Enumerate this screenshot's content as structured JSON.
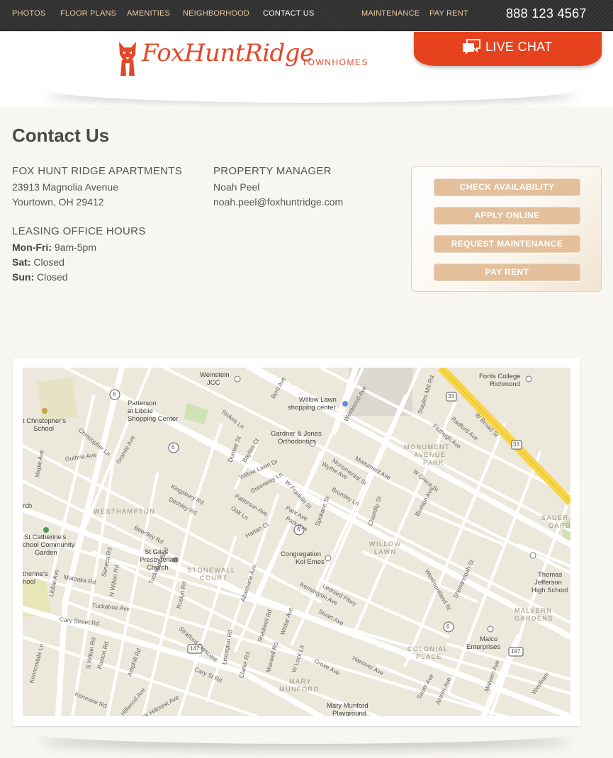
{
  "nav": {
    "items": [
      {
        "label": "PHOTOS"
      },
      {
        "label": "FLOOR PLANS"
      },
      {
        "label": "AMENITIES"
      },
      {
        "label": "NEIGHBORHOOD"
      },
      {
        "label": "CONTACT US",
        "active": true
      },
      {
        "label": "MAINTENANCE"
      },
      {
        "label": "PAY RENT"
      }
    ],
    "phone": "888 123 4567"
  },
  "brand": {
    "name": "FoxHuntRidge",
    "suffix": "TOWNHOMES",
    "accent": "#e2492a",
    "logo_icon": "fox-icon"
  },
  "live_chat": {
    "label": "LIVE CHAT",
    "icon": "chat-bubbles-icon",
    "color": "#e7421e"
  },
  "page": {
    "title": "Contact Us"
  },
  "contact": {
    "property": {
      "heading": "FOX HUNT RIDGE APARTMENTS",
      "street": "23913 Magnolia Avenue",
      "city": "Yourtown, OH 29412"
    },
    "manager": {
      "heading": "PROPERTY MANAGER",
      "name": "Noah Peel",
      "email": "noah.peel@foxhuntridge.com"
    },
    "hours": {
      "heading": "LEASING OFFICE HOURS",
      "rows": [
        {
          "day": "Mon-Fri:",
          "time": "9am-5pm"
        },
        {
          "day": "Sat:",
          "time": "Closed"
        },
        {
          "day": "Sun:",
          "time": "Closed"
        }
      ]
    }
  },
  "actions": {
    "buttons": [
      {
        "label": "CHECK AVAILABILITY"
      },
      {
        "label": "APPLY ONLINE"
      },
      {
        "label": "REQUEST MAINTENANCE"
      },
      {
        "label": "PAY RENT"
      }
    ],
    "button_color": "#e3bf9c"
  },
  "map": {
    "areas": [
      "WESTHAMPTON",
      "STONEWALL",
      "COURT",
      "MONUMENT",
      "AVENUE",
      "PARK",
      "WILLOW",
      "LAWN",
      "MALVERN",
      "GARDENS",
      "COLONIAL",
      "PLACE",
      "MARY",
      "MUNFORD",
      "SAUER",
      "GARDE"
    ],
    "pois": [
      "Weinstein",
      "JCC",
      "Willow Lawn",
      "shopping center",
      "Patterson",
      "at Libbie",
      "Shopping Center",
      "t Christopher's",
      "School",
      "Gardner & Jones",
      "Orthodontics",
      "Fortis College",
      "Richmond",
      "St Catherine's",
      "chool Community",
      "Garden",
      "St Giles",
      "Presbyterian",
      "Church",
      "Congregation",
      "Kol Emes",
      "therine's",
      "hool",
      "Thomas",
      "Jefferson",
      "High School",
      "Malco",
      "Enterprises",
      "Mary Munford",
      "Playground",
      "rch"
    ],
    "roads": [
      "Libbie Ave",
      "Patterson Ave",
      "Monument Ave",
      "Grove Ave",
      "Cary Street Rd",
      "Cary St Rd",
      "W Broad St",
      "Willow Lawn Dr",
      "Kensington Ave",
      "Stuart Ave",
      "Malvern Ave",
      "Tuckahoe Ave",
      "Matoaka Rd",
      "Granite Ave",
      "Maple Ave",
      "Guthrie Ave",
      "Christopher Ln",
      "Stokes Ln",
      "Dunbar St",
      "Bayliss Ct",
      "Greenway Ln",
      "W Franklin St",
      "Park Ave",
      "Wythe Ave",
      "Bromley Ln",
      "Monumental St",
      "Chantilly St",
      "Spokane St",
      "Kingsbury Rd",
      "Ditchley Rd",
      "Bewdley Rd",
      "Oak Ln",
      "Harlan Ct",
      "Albemarle Ave",
      "Leonard Pkwy",
      "Shadwell Rd",
      "Wistar Ave",
      "W Lock Ln",
      "Maxwell Rd",
      "Clarke Rd",
      "Lexington Rd",
      "Roslyn Rd",
      "Stratford Crescent",
      "Hanover Ave",
      "Sauer Ave",
      "Antrim Ave",
      "Westmoreland St",
      "Shenandoah St",
      "Blanton Ave",
      "Staples Mill Rd",
      "Radford Ave",
      "Fitzhugh Ave",
      "W Grace St",
      "Byrd Ave",
      "Westwood Ave",
      "Kenmore Rd",
      "Hillwood Ave",
      "W Hillcrest Ave",
      "Amphill Rd",
      "Paxton Rd",
      "S Wilton Rd",
      "Kennondale Ln",
      "Seneca Rd",
      "N Wilton Rd",
      "Tuckahoe Blvd",
      "Park Ave",
      "Westham"
    ],
    "shields": [
      "6",
      "6",
      "6",
      "6",
      "33",
      "33",
      "147",
      "197"
    ]
  }
}
